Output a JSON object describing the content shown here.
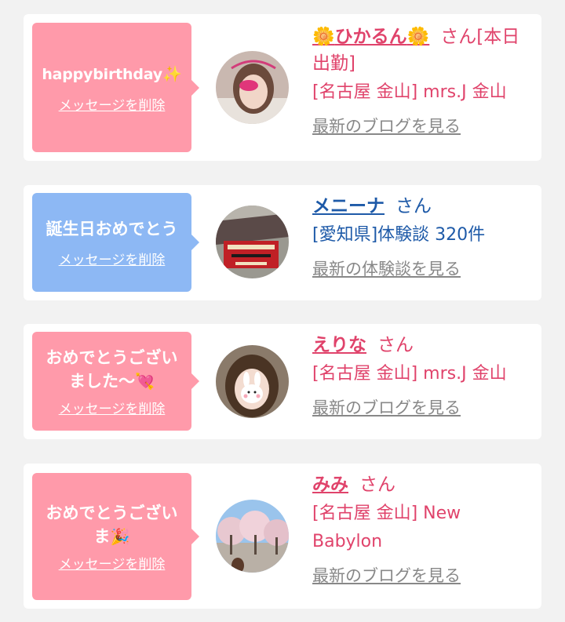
{
  "cards": [
    {
      "message": "happybirthday",
      "message_emoji": "✨",
      "delete_label": "メッセージを削除",
      "name_prefix": "🌼",
      "name": "ひかるん",
      "name_suffix": "🌼",
      "honorific": "さん",
      "status": "[本日出勤]",
      "shop": "[名古屋 金山] mrs.J 金山",
      "more_label": "最新のブログを見る",
      "bubble_color": "#ff9aaa",
      "text_color": "#e0436b"
    },
    {
      "message": "誕生日おめでとう",
      "delete_label": "メッセージを削除",
      "name": "メニーナ",
      "honorific": "さん",
      "shop": "[愛知県]体験談 320件",
      "more_label": "最新の体験談を見る",
      "bubble_color": "#8db8f4",
      "text_color": "#1e5aa8"
    },
    {
      "message": "おめでとうございました〜",
      "message_emoji": "💘",
      "delete_label": "メッセージを削除",
      "name": "えりな",
      "honorific": "さん",
      "shop": "[名古屋 金山] mrs.J 金山",
      "more_label": "最新のブログを見る",
      "bubble_color": "#ff9aaa",
      "text_color": "#e0436b"
    },
    {
      "message": "おめでとうございま",
      "message_emoji": "🎉",
      "delete_label": "メッセージを削除",
      "name": "みみ",
      "honorific": "さん",
      "shop": "[名古屋 金山] New Babylon",
      "more_label": "最新のブログを見る",
      "bubble_color": "#ff9aaa",
      "text_color": "#e0436b"
    }
  ]
}
